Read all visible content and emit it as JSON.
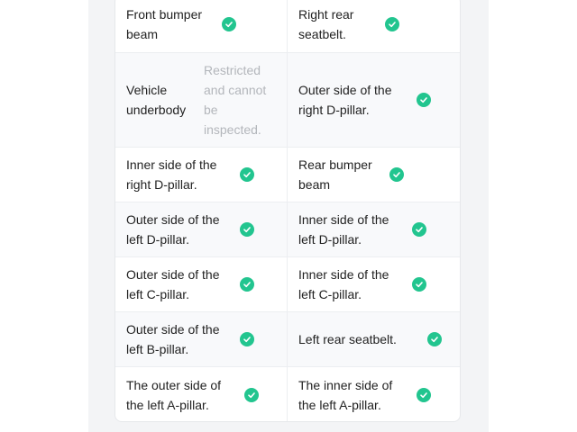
{
  "rows": [
    {
      "left": {
        "label": "Front bumper beam",
        "status": "check"
      },
      "right": {
        "label": "Right rear seatbelt.",
        "status": "check"
      }
    },
    {
      "left": {
        "label": "Vehicle underbody",
        "status": "text",
        "status_text": "Restricted and cannot be inspected."
      },
      "right": {
        "label": "Outer side of the right D-pillar.",
        "status": "check"
      }
    },
    {
      "left": {
        "label": "Inner side of the right D-pillar.",
        "status": "check"
      },
      "right": {
        "label": "Rear bumper beam",
        "status": "check"
      }
    },
    {
      "left": {
        "label": "Outer side of the left D-pillar.",
        "status": "check"
      },
      "right": {
        "label": "Inner side of the left D-pillar.",
        "status": "check"
      }
    },
    {
      "left": {
        "label": "Outer side of the left C-pillar.",
        "status": "check"
      },
      "right": {
        "label": "Inner side of the left C-pillar.",
        "status": "check"
      }
    },
    {
      "left": {
        "label": "Outer side of the left B-pillar.",
        "status": "check"
      },
      "right": {
        "label": "Left rear seatbelt.",
        "status": "check"
      }
    },
    {
      "left": {
        "label": "The outer side of the left A-pillar.",
        "status": "check"
      },
      "right": {
        "label": "The inner side of the left A-pillar.",
        "status": "check"
      }
    }
  ],
  "colors": {
    "check": "#22c58f",
    "muted_text": "#b3b6bb"
  },
  "icons": {
    "check": "check-circle-icon"
  }
}
